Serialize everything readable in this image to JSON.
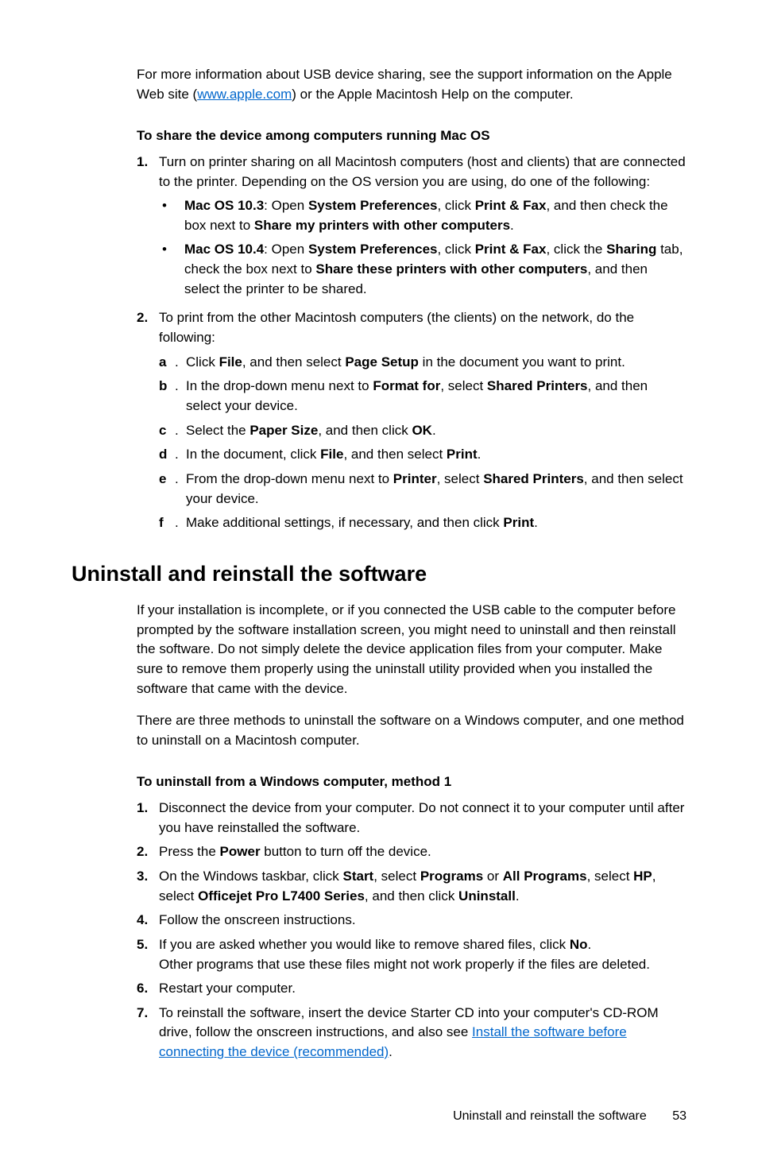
{
  "intro": {
    "p1a": "For more information about USB device sharing, see the support information on the Apple Web site (",
    "link1": "www.apple.com",
    "p1b": ") or the Apple Macintosh Help on the computer."
  },
  "share": {
    "heading": "To share the device among computers running Mac OS",
    "step1": "Turn on printer sharing on all Macintosh computers (host and clients) that are connected to the printer. Depending on the OS version you are using, do one of the following:",
    "b1": {
      "a": "Mac OS 10.3",
      "b": ": Open ",
      "c": "System Preferences",
      "d": ", click ",
      "e": "Print & Fax",
      "f": ", and then check the box next to ",
      "g": "Share my printers with other computers",
      "h": "."
    },
    "b2": {
      "a": "Mac OS 10.4",
      "b": ": Open ",
      "c": "System Preferences",
      "d": ", click ",
      "e": "Print & Fax",
      "f": ", click the ",
      "g": "Sharing",
      "h": " tab, check the box next to ",
      "i": "Share these printers with other computers",
      "j": ", and then select the printer to be shared."
    },
    "step2": "To print from the other Macintosh computers (the clients) on the network, do the following:",
    "la": {
      "a": "Click ",
      "b": "File",
      "c": ", and then select ",
      "d": "Page Setup",
      "e": " in the document you want to print."
    },
    "lb": {
      "a": "In the drop-down menu next to ",
      "b": "Format for",
      "c": ", select ",
      "d": "Shared Printers",
      "e": ", and then select your device."
    },
    "lc": {
      "a": "Select the ",
      "b": "Paper Size",
      "c": ", and then click ",
      "d": "OK",
      "e": "."
    },
    "ld": {
      "a": "In the document, click ",
      "b": "File",
      "c": ", and then select ",
      "d": "Print",
      "e": "."
    },
    "le": {
      "a": "From the drop-down menu next to ",
      "b": "Printer",
      "c": ", select ",
      "d": "Shared Printers",
      "e": ", and then select your device."
    },
    "lf": {
      "a": "Make additional settings, if necessary, and then click ",
      "b": "Print",
      "c": "."
    }
  },
  "uninstall": {
    "heading": "Uninstall and reinstall the software",
    "p1": "If your installation is incomplete, or if you connected the USB cable to the computer before prompted by the software installation screen, you might need to uninstall and then reinstall the software. Do not simply delete the device application files from your computer. Make sure to remove them properly using the uninstall utility provided when you installed the software that came with the device.",
    "p2": "There are three methods to uninstall the software on a Windows computer, and one method to uninstall on a Macintosh computer.",
    "heading2": "To uninstall from a Windows computer, method 1",
    "s1": "Disconnect the device from your computer. Do not connect it to your computer until after you have reinstalled the software.",
    "s2": {
      "a": "Press the ",
      "b": "Power",
      "c": " button to turn off the device."
    },
    "s3": {
      "a": "On the Windows taskbar, click ",
      "b": "Start",
      "c": ", select ",
      "d": "Programs",
      "e": " or ",
      "f": "All Programs",
      "g": ", select ",
      "h": "HP",
      "i": ", select ",
      "j": "Officejet Pro L7400 Series",
      "k": ", and then click ",
      "l": "Uninstall",
      "m": "."
    },
    "s4": "Follow the onscreen instructions.",
    "s5": {
      "a": "If you are asked whether you would like to remove shared files, click ",
      "b": "No",
      "c": ".",
      "d": "Other programs that use these files might not work properly if the files are deleted."
    },
    "s6": "Restart your computer.",
    "s7": {
      "a": "To reinstall the software, insert the device Starter CD into your computer's CD-ROM drive, follow the onscreen instructions, and also see ",
      "link": "Install the software before connecting the device (recommended)",
      "b": "."
    }
  },
  "footer": {
    "text": "Uninstall and reinstall the software",
    "page": "53"
  }
}
